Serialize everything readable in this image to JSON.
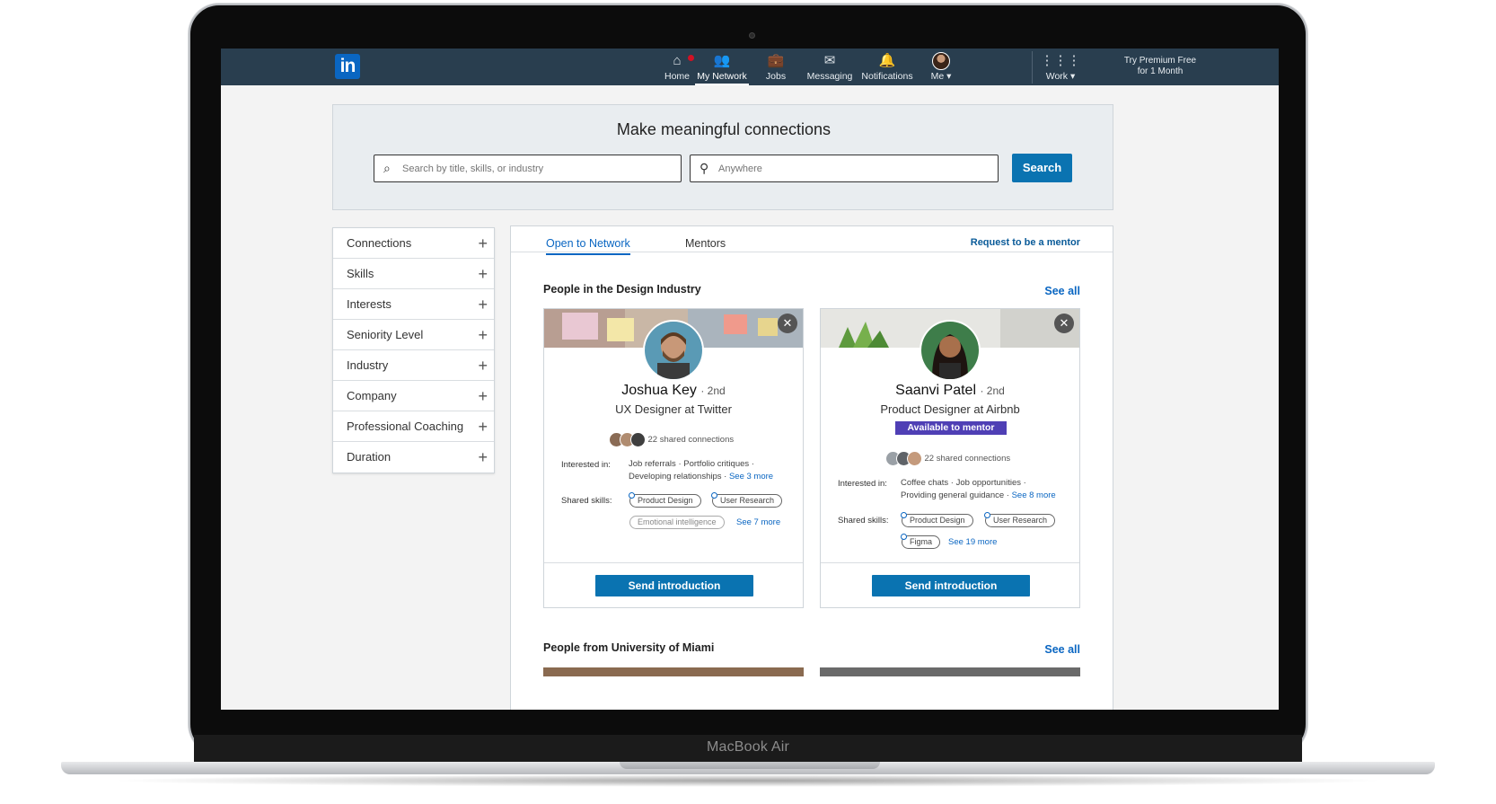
{
  "device": {
    "label": "MacBook Air"
  },
  "nav": {
    "items": [
      {
        "label": "Home"
      },
      {
        "label": "My Network"
      },
      {
        "label": "Jobs"
      },
      {
        "label": "Messaging"
      },
      {
        "label": "Notifications"
      },
      {
        "label": "Me"
      },
      {
        "label": "Work"
      }
    ],
    "premium_line1": "Try Premium Free",
    "premium_line2": "for 1 Month",
    "logo": "in"
  },
  "hero": {
    "title": "Make meaningful connections",
    "search_placeholder": "Search by title, skills, or industry",
    "location_placeholder": "Anywhere",
    "search_button": "Search"
  },
  "filters": [
    "Connections",
    "Skills",
    "Interests",
    "Seniority Level",
    "Industry",
    "Company",
    "Professional Coaching",
    "Duration"
  ],
  "tabs": {
    "open": "Open to Network",
    "mentors": "Mentors",
    "request": "Request to be a mentor"
  },
  "sections": [
    {
      "title": "People in the Design Industry",
      "see_all": "See all"
    },
    {
      "title": "People from University of Miami",
      "see_all": "See all"
    }
  ],
  "cards": [
    {
      "name": "Joshua Key",
      "degree": "· 2nd",
      "title": "UX Designer at Twitter",
      "shared": "22 shared connections",
      "interested_label": "Interested in:",
      "interest1": "Job referrals",
      "interest2": "Portfolio critiques",
      "interest3": "Developing relationships",
      "interest_more": "See 3 more",
      "skills_label": "Shared skills:",
      "skill1": "Product Design",
      "skill2": "User Research",
      "skill3": "Emotional intelligence",
      "skill_more": "See 7 more",
      "button": "Send introduction"
    },
    {
      "name": "Saanvi Patel",
      "degree": "· 2nd",
      "title": "Product Designer at Airbnb",
      "badge": "Available to mentor",
      "shared": "22 shared connections",
      "interested_label": "Interested in:",
      "interest1": "Coffee chats",
      "interest2": "Job opportunities",
      "interest3": "Providing general guidance",
      "interest_more": "See 8 more",
      "skills_label": "Shared skills:",
      "skill1": "Product Design",
      "skill2": "User Research",
      "skill3": "Figma",
      "skill_more": "See 19 more",
      "button": "Send introduction"
    }
  ],
  "colors": {
    "nav": "#293e4f",
    "primary": "#0a73b1",
    "mentor_badge": "#4f3fb5",
    "notification": "#d11124"
  }
}
